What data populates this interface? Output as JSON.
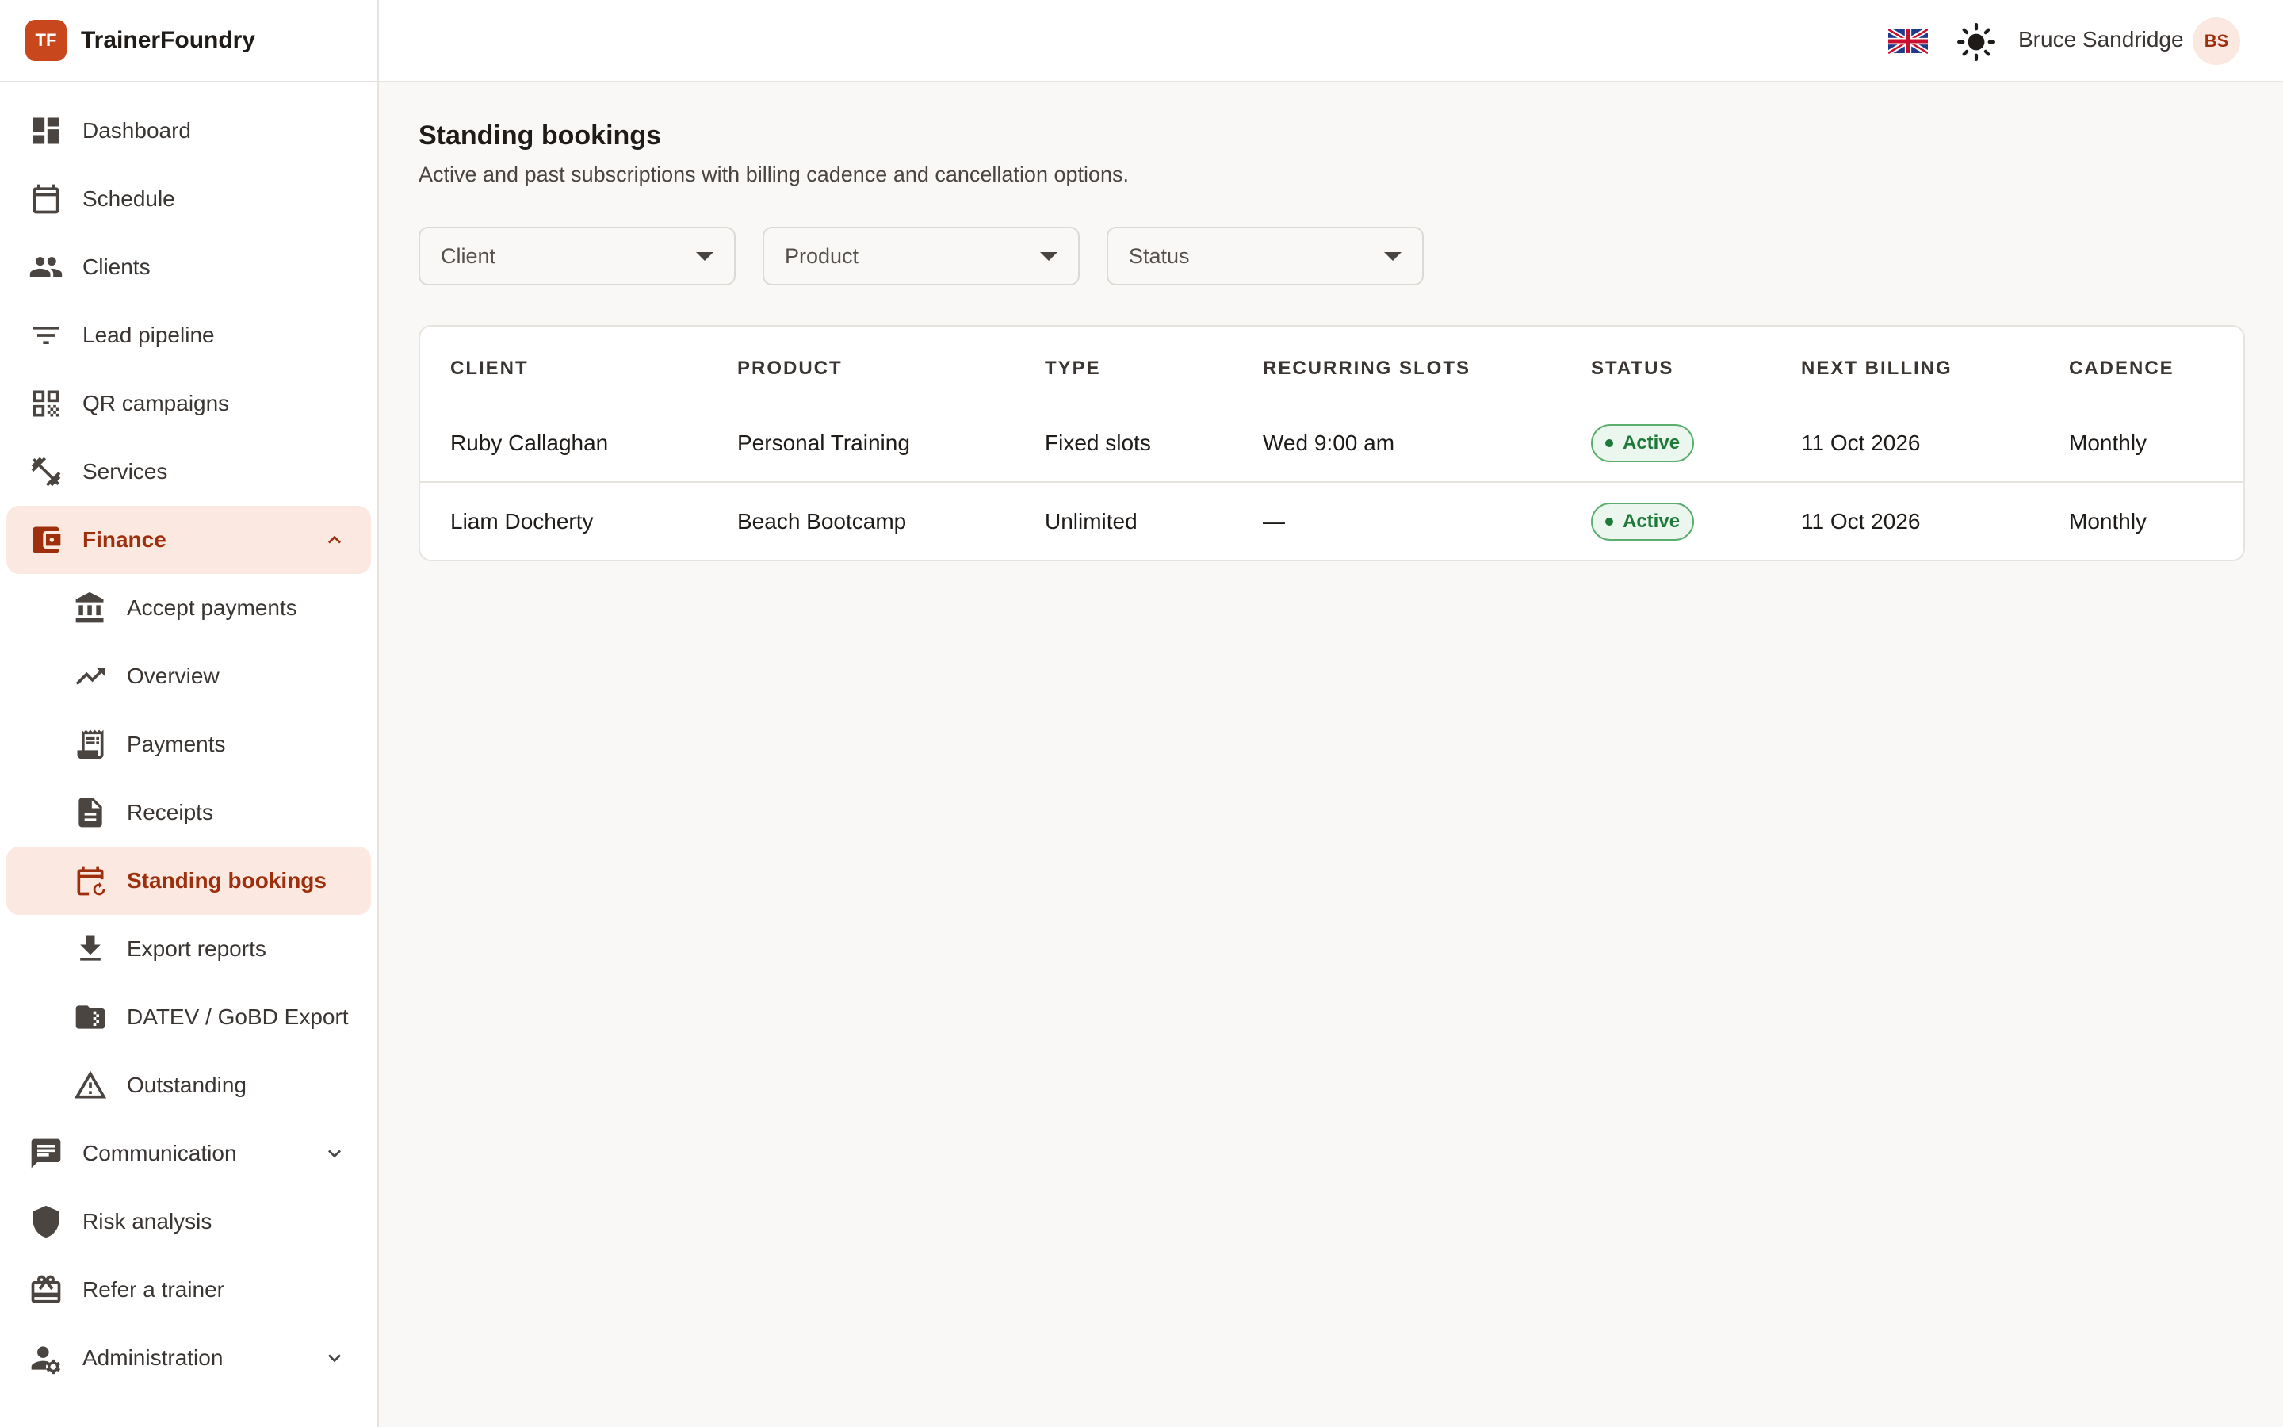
{
  "brand": {
    "logo": "TF",
    "name": "TrainerFoundry"
  },
  "sidebar": {
    "items": [
      {
        "label": "Dashboard",
        "icon": "dashboard-icon"
      },
      {
        "label": "Schedule",
        "icon": "calendar-icon"
      },
      {
        "label": "Clients",
        "icon": "people-icon"
      },
      {
        "label": "Lead pipeline",
        "icon": "filter-icon"
      },
      {
        "label": "QR campaigns",
        "icon": "qr-code-icon"
      },
      {
        "label": "Services",
        "icon": "dumbbell-icon"
      },
      {
        "label": "Finance",
        "icon": "wallet-icon",
        "expanded": true
      },
      {
        "label": "Accept payments",
        "icon": "bank-icon"
      },
      {
        "label": "Overview",
        "icon": "trending-up-icon"
      },
      {
        "label": "Payments",
        "icon": "receipt-long-icon"
      },
      {
        "label": "Receipts",
        "icon": "document-icon"
      },
      {
        "label": "Standing bookings",
        "icon": "calendar-repeat-icon",
        "active": true
      },
      {
        "label": "Export reports",
        "icon": "download-icon"
      },
      {
        "label": "DATEV / GoBD Export",
        "icon": "folder-icon"
      },
      {
        "label": "Outstanding",
        "icon": "warning-icon"
      },
      {
        "label": "Communication",
        "icon": "chat-icon"
      },
      {
        "label": "Risk analysis",
        "icon": "shield-icon"
      },
      {
        "label": "Refer a trainer",
        "icon": "gift-icon"
      },
      {
        "label": "Administration",
        "icon": "admin-settings-icon"
      }
    ]
  },
  "header": {
    "language_icon": "uk-flag-icon",
    "theme_icon": "sun-icon",
    "user_name": "Bruce Sandridge",
    "user_initials": "BS"
  },
  "page": {
    "title": "Standing bookings",
    "subtitle": "Active and past subscriptions with billing cadence and cancellation options."
  },
  "filters": {
    "client": "Client",
    "product": "Product",
    "status": "Status"
  },
  "table": {
    "columns": [
      "CLIENT",
      "PRODUCT",
      "TYPE",
      "RECURRING SLOTS",
      "STATUS",
      "NEXT BILLING",
      "CADENCE"
    ],
    "rows": [
      {
        "client": "Ruby Callaghan",
        "product": "Personal Training",
        "type": "Fixed slots",
        "slots": "Wed 9:00 am",
        "status": "Active",
        "next_billing": "11 Oct 2026",
        "cadence": "Monthly"
      },
      {
        "client": "Liam Docherty",
        "product": "Beach Bootcamp",
        "type": "Unlimited",
        "slots": "—",
        "status": "Active",
        "next_billing": "11 Oct 2026",
        "cadence": "Monthly"
      }
    ]
  },
  "colors": {
    "accent": "#c8471d",
    "active_text": "#9e2f0c",
    "active_bg": "#fbe8e1",
    "status_active": "#1f7a3a"
  }
}
